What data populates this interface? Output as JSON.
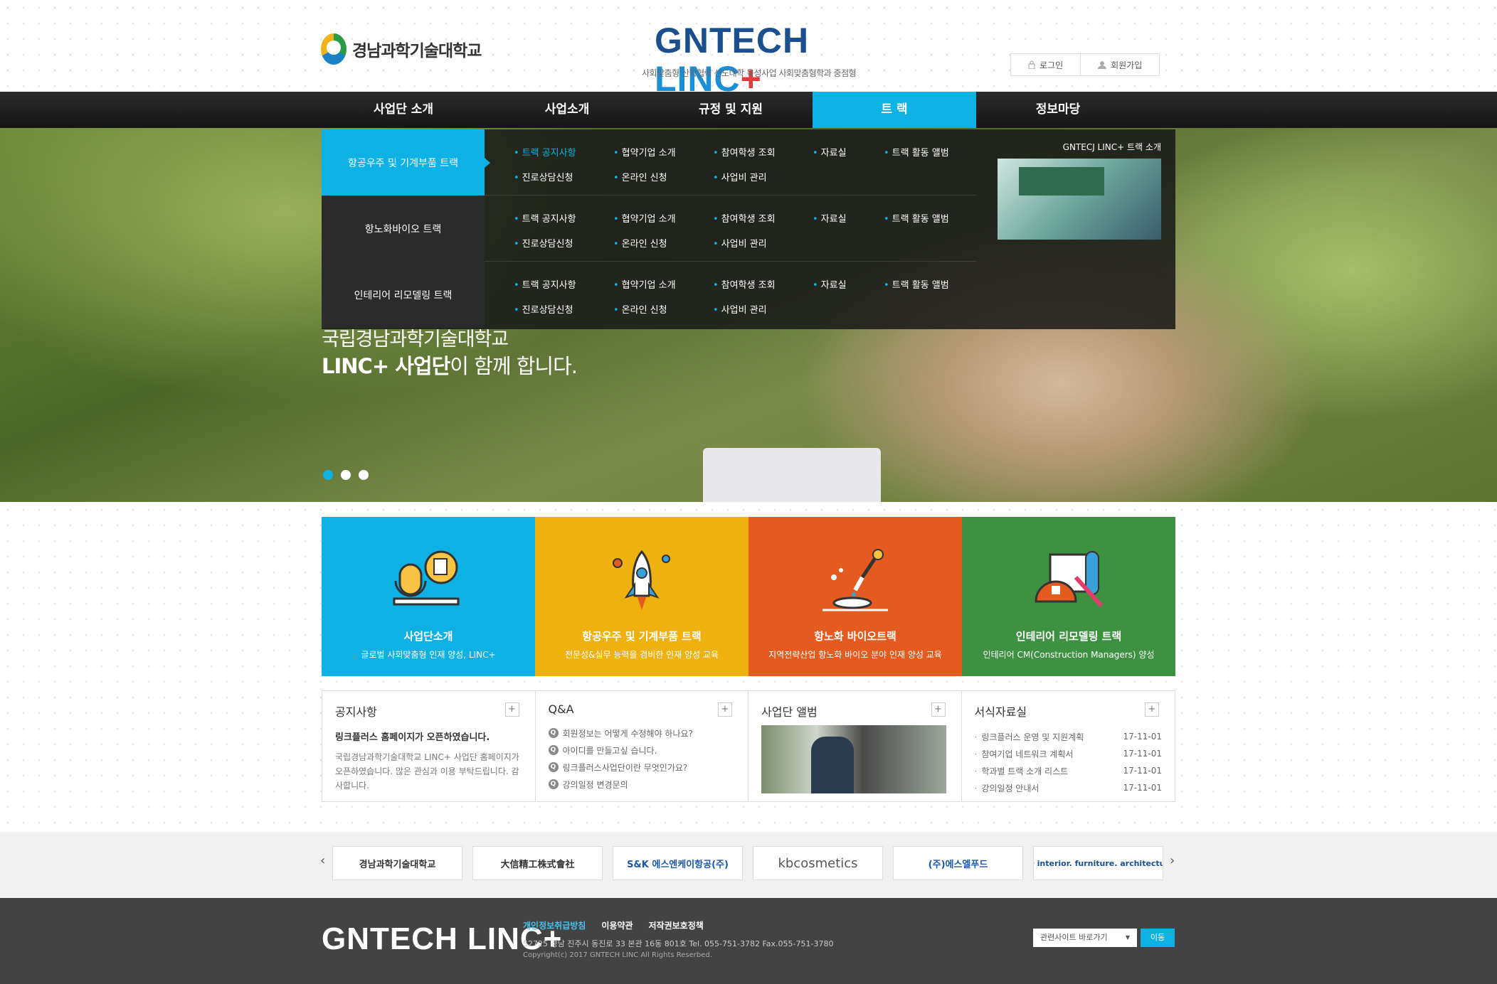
{
  "header": {
    "logo_text": "경남과학기술대학교",
    "brand": {
      "part1": "GNTECH ",
      "part2": "LINC",
      "part3": "+"
    },
    "brand_sub": "사회맞춤형 산학협력 선도대학 육성사업 사회맞춤형학과 중점형",
    "login": "로그인",
    "signup": "회원가입"
  },
  "gnb": [
    "사업단 소개",
    "사업소개",
    "규정 및 지원",
    "트 랙",
    "정보마당"
  ],
  "mega": {
    "tracks": [
      {
        "name": "항공우주 및 기계부품 트랙",
        "links": [
          "트랙 공지사항",
          "협약기업 소개",
          "참여학생 조회",
          "자료실",
          "트랙 활동 앨범",
          "진로상담신청",
          "온라인 신청",
          "사업비 관리"
        ]
      },
      {
        "name": "항노화바이오 트랙",
        "links": [
          "트랙 공지사항",
          "협약기업 소개",
          "참여학생 조회",
          "자료실",
          "트랙 활동 앨범",
          "진로상담신청",
          "온라인 신청",
          "사업비 관리"
        ]
      },
      {
        "name": "인테리어 리모델링 트랙",
        "links": [
          "트랙 공지사항",
          "협약기업 소개",
          "참여학생 조회",
          "자료실",
          "트랙 활동 앨범",
          "진로상담신청",
          "온라인 신청",
          "사업비 관리"
        ]
      }
    ],
    "aside_title": "GNTECJ LINC+ 트랙 소개"
  },
  "hero": {
    "line1": "국립경남과학기술대학교",
    "line2_bold": "LINC+ 사업단",
    "line2_rest": "이 함께 합니다."
  },
  "quick": [
    {
      "title": "사업단소개",
      "desc": "글로벌 사회맞춤형 인재 양성, LINC+",
      "color": "#0db1e4"
    },
    {
      "title": "항공우주 및 기계부품 트랙",
      "desc": "전문성&실무 능력을 겸비한 인재 양성 교육",
      "color": "#eeb10f"
    },
    {
      "title": "항노화 바이오트랙",
      "desc": "지역전략산업 항노화 바이오 분야 인재 양성 교육",
      "color": "#e55b1f"
    },
    {
      "title": "인테리어 리모델링 트랙",
      "desc": "인테리어 CM(Construction Managers) 양성",
      "color": "#3f9142"
    }
  ],
  "boards": {
    "notice": {
      "title": "공지사항",
      "headline": "링크플러스 홈페이지가 오픈하였습니다.",
      "body": "국립경남과학기술대학교 LINC+ 사업단 홈페이지가 오픈하였습니다. 많은 관심과 이용 부탁드립니다. 감사합니다."
    },
    "qa": {
      "title": "Q&A",
      "items": [
        "회원정보는 어떻게 수정해야 하나요?",
        "아이디를 만들고싶 습니다.",
        "링크플러스사업단이란 무엇인가요?",
        "강의일정 변경문의"
      ]
    },
    "album": {
      "title": "사업단 앨범"
    },
    "files": {
      "title": "서식자료실",
      "items": [
        {
          "name": "링크플러스 운영 및 지원계획",
          "date": "17-11-01"
        },
        {
          "name": "참여기업 네트워크 계획서",
          "date": "17-11-01"
        },
        {
          "name": "학과별 트랙 소개 리스트",
          "date": "17-11-01"
        },
        {
          "name": "강의일정 안내서",
          "date": "17-11-01"
        }
      ]
    },
    "more": "+"
  },
  "partners": [
    {
      "name": "경남과학기술대학교",
      "color": "#333333"
    },
    {
      "name": "大信精工株式會社",
      "color": "#333333"
    },
    {
      "name": "S&K 에스엔케이항공(주)",
      "color": "#1a57a8"
    },
    {
      "name": "kbcosmetics",
      "color": "#555555"
    },
    {
      "name": "(주)에스엘푸드",
      "color": "#1a57a8"
    },
    {
      "name": "ZIO interior. furniture. architecture.",
      "color": "#1b4f8d"
    }
  ],
  "footer": {
    "logo": "GNTECH LINC+",
    "links": [
      "개인정보취급방침",
      "이용약관",
      "저작권보호정책"
    ],
    "address": "52725 경남 진주시 동진로 33 본관 16동 801호   Tel. 055-751-3782   Fax.055-751-3780",
    "copyright": "Copyright(c) 2017 GNTECH LINC All Rights Reserbed.",
    "select": "관련사이트 바로가기",
    "go": "이동"
  }
}
